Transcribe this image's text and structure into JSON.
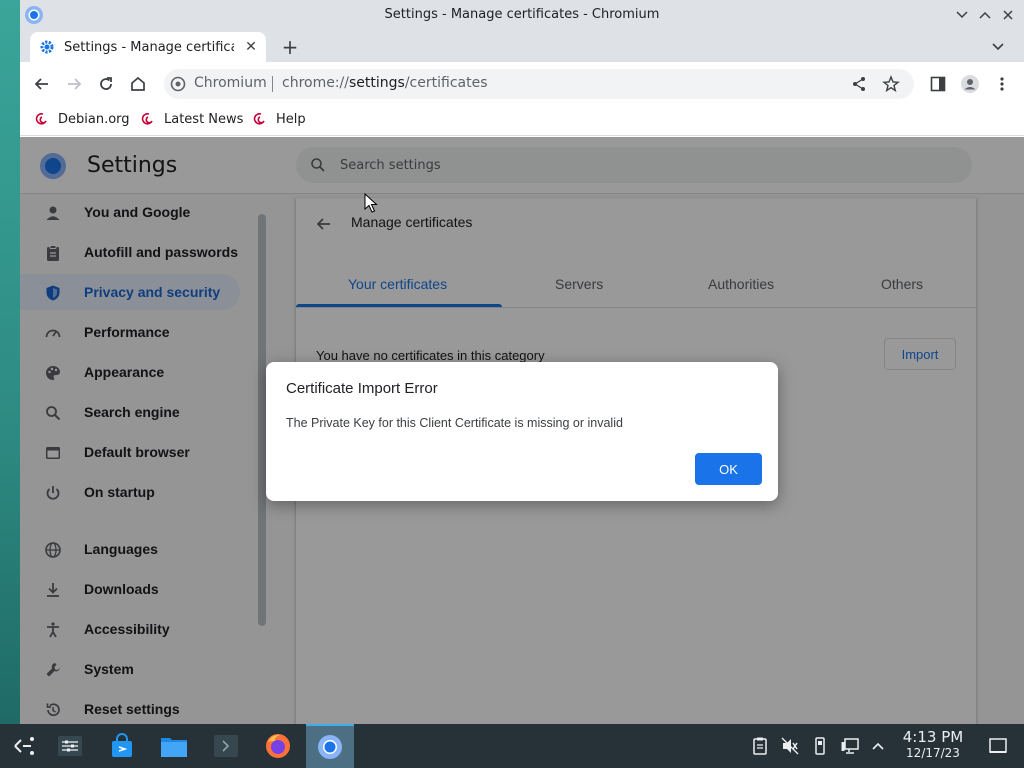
{
  "window": {
    "title": "Settings - Manage certificates - Chromium"
  },
  "tab": {
    "title": "Settings - Manage certificate"
  },
  "omnibox": {
    "chip": "Chromium",
    "url_prefix": "chrome://",
    "url_host": "settings",
    "url_path": "/certificates"
  },
  "bookmarks": [
    {
      "label": "Debian.org"
    },
    {
      "label": "Latest News"
    },
    {
      "label": "Help"
    }
  ],
  "settings": {
    "title": "Settings",
    "search_placeholder": "Search settings",
    "sidebar": [
      {
        "label": "You and Google",
        "icon": "person-icon"
      },
      {
        "label": "Autofill and passwords",
        "icon": "clipboard-icon"
      },
      {
        "label": "Privacy and security",
        "icon": "shield-icon",
        "active": true
      },
      {
        "label": "Performance",
        "icon": "speedometer-icon"
      },
      {
        "label": "Appearance",
        "icon": "palette-icon"
      },
      {
        "label": "Search engine",
        "icon": "search-icon"
      },
      {
        "label": "Default browser",
        "icon": "browser-icon"
      },
      {
        "label": "On startup",
        "icon": "power-icon"
      },
      {
        "label": "Languages",
        "icon": "globe-icon"
      },
      {
        "label": "Downloads",
        "icon": "download-icon"
      },
      {
        "label": "Accessibility",
        "icon": "accessibility-icon"
      },
      {
        "label": "System",
        "icon": "wrench-icon"
      },
      {
        "label": "Reset settings",
        "icon": "reset-icon"
      }
    ],
    "page_title": "Manage certificates",
    "tabs": [
      "Your certificates",
      "Servers",
      "Authorities",
      "Others"
    ],
    "selected_tab": "Your certificates",
    "empty_text": "You have no certificates in this category",
    "import_label": "Import"
  },
  "dialog": {
    "title": "Certificate Import Error",
    "message": "The Private Key for this Client Certificate is missing or invalid",
    "ok_label": "OK"
  },
  "taskbar": {
    "time": "4:13 PM",
    "date": "12/17/23"
  },
  "colors": {
    "accent": "#1a73e8",
    "taskbar": "#263238",
    "active_nav_bg": "#e8f0fe"
  }
}
